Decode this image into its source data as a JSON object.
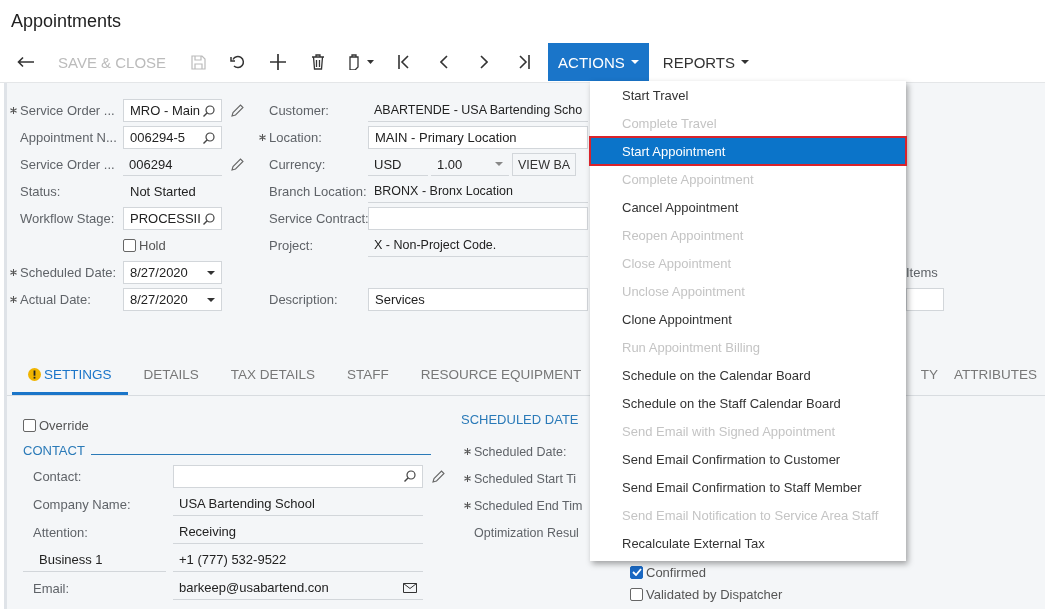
{
  "title": "Appointments",
  "toolbar": {
    "save_close": {
      "label": "SAVE & CLOSE",
      "disabled": true
    },
    "actions": {
      "label": "ACTIONS",
      "expanded": true
    },
    "reports": {
      "label": "REPORTS"
    }
  },
  "left_fields": [
    {
      "kind": "lookup",
      "label": "Service Order ...",
      "required": true,
      "value": "MRO - Main",
      "editable": true
    },
    {
      "kind": "lookup",
      "label": "Appointment N...",
      "required": false,
      "value": "006294-5",
      "editable": false
    },
    {
      "kind": "text",
      "label": "Service Order ...",
      "required": false,
      "value": "006294",
      "editable": true
    },
    {
      "kind": "plain",
      "label": "Status:",
      "required": false,
      "value": "Not Started",
      "editable": false
    },
    {
      "kind": "lookup",
      "label": "Workflow Stage:",
      "required": false,
      "value": "PROCESSII",
      "editable": false
    },
    {
      "kind": "checkbox",
      "label": "Hold",
      "checked": false
    },
    {
      "kind": "date",
      "label": "Scheduled Date:",
      "required": true,
      "value": "8/27/2020",
      "editable": false
    },
    {
      "kind": "date",
      "label": "Actual Date:",
      "required": true,
      "value": "8/27/2020",
      "editable": false
    }
  ],
  "mid_fields": [
    {
      "kind": "text",
      "label": "Customer:",
      "required": false,
      "value": "ABARTENDE - USA Bartending Scho"
    },
    {
      "kind": "box",
      "label": "Location:",
      "required": true,
      "value": "MAIN - Primary Location"
    },
    {
      "kind": "currency",
      "label": "Currency:",
      "required": false,
      "value": "USD",
      "rate": "1.00",
      "button": "VIEW BA"
    },
    {
      "kind": "text",
      "label": "Branch Location:",
      "required": false,
      "value": "BRONX - Bronx Location"
    },
    {
      "kind": "box",
      "label": "Service Contract:",
      "required": false
    },
    {
      "kind": "text",
      "label": "Project:",
      "required": false,
      "value": "X - Non-Project Code."
    },
    {
      "kind": "blank"
    },
    {
      "kind": "box",
      "label": "Description:",
      "required": false,
      "value": "Services"
    }
  ],
  "right_fields": [
    {
      "label": "Items"
    }
  ],
  "tabs": [
    {
      "label": "SETTINGS",
      "selected": true,
      "warning": true
    },
    {
      "label": "DETAILS",
      "selected": false,
      "warning": false
    },
    {
      "label": "TAX DETAILS",
      "selected": false,
      "warning": false
    },
    {
      "label": "STAFF",
      "selected": false,
      "warning": false
    },
    {
      "label": "RESOURCE EQUIPMENT",
      "selected": false,
      "warning": false
    }
  ],
  "tabs_right": [
    {
      "label": "TY",
      "selected": false,
      "warning": false
    },
    {
      "label": "ATTRIBUTES",
      "selected": false,
      "warning": false
    }
  ],
  "override": {
    "label": "Override",
    "checked": false
  },
  "contact": {
    "title": "CONTACT",
    "rows": [
      {
        "kind": "lookup",
        "label": "Contact:",
        "editable": true
      },
      {
        "kind": "text",
        "label": "Company Name:",
        "value": "USA Bartending School"
      },
      {
        "kind": "text",
        "label": "Attention:",
        "value": "Receiving"
      },
      {
        "kind": "phone",
        "label": "Business 1",
        "value": "+1 (777) 532-9522"
      },
      {
        "kind": "email",
        "label": "Email:",
        "value": "barkeep@usabartend.con"
      }
    ]
  },
  "scheduled": {
    "title": "SCHEDULED DATE",
    "rows": [
      {
        "label": "Scheduled Date:",
        "required": true
      },
      {
        "label": "Scheduled Start Ti",
        "required": true
      },
      {
        "label": "Scheduled End Tim",
        "required": true
      },
      {
        "label": "Optimization Resul",
        "required": false
      }
    ]
  },
  "flags": [
    {
      "label": "Confirmed",
      "checked": true
    },
    {
      "label": "Validated by Dispatcher",
      "checked": false
    }
  ],
  "menu": [
    {
      "label": "Start Travel",
      "disabled": false,
      "selected": false
    },
    {
      "label": "Complete Travel",
      "disabled": true,
      "selected": false
    },
    {
      "label": "Start Appointment",
      "disabled": false,
      "selected": true
    },
    {
      "label": "Complete Appointment",
      "disabled": true,
      "selected": false
    },
    {
      "label": "Cancel Appointment",
      "disabled": false,
      "selected": false
    },
    {
      "label": "Reopen Appointment",
      "disabled": true,
      "selected": false
    },
    {
      "label": "Close Appointment",
      "disabled": true,
      "selected": false
    },
    {
      "label": "Unclose Appointment",
      "disabled": true,
      "selected": false
    },
    {
      "label": "Clone Appointment",
      "disabled": false,
      "selected": false
    },
    {
      "label": "Run Appointment Billing",
      "disabled": true,
      "selected": false
    },
    {
      "label": "Schedule on the Calendar Board",
      "disabled": false,
      "selected": false
    },
    {
      "label": "Schedule on the Staff Calendar Board",
      "disabled": false,
      "selected": false
    },
    {
      "label": "Send Email with Signed Appointment",
      "disabled": true,
      "selected": false
    },
    {
      "label": "Send Email Confirmation to Customer",
      "disabled": false,
      "selected": false
    },
    {
      "label": "Send Email Confirmation to Staff Member",
      "disabled": false,
      "selected": false
    },
    {
      "label": "Send Email Notification to Service Area Staff",
      "disabled": true,
      "selected": false
    },
    {
      "label": "Recalculate External Tax",
      "disabled": false,
      "selected": false
    }
  ]
}
